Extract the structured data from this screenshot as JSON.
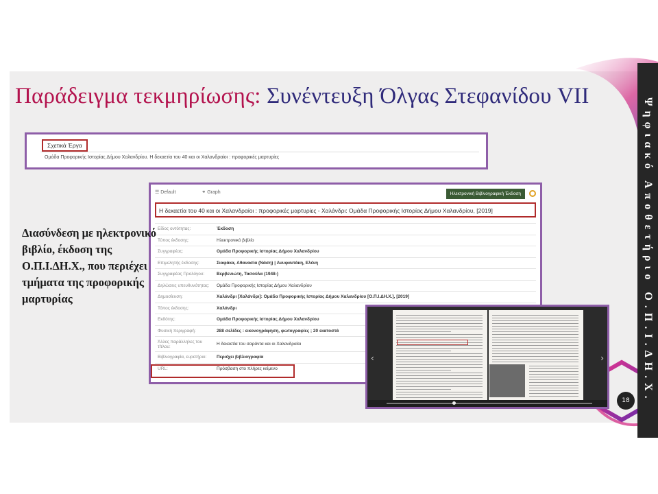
{
  "slide": {
    "title_part1": "Παράδειγμα τεκμηρίωσης:",
    "title_part2": "Συνέντευξη Όλγας Στεφανίδου VII",
    "side_text": "Διασύνδεση με ηλεκτρονικό βιβλίο, έκδοση της Ο.Π.Ι.ΔΗ.Χ., που περιέχει τμήματα της προφορικής μαρτυρίας",
    "sidebar_text": "Ψηφιακό  Αποθετήριο  Ο.Π.Ι.ΔΗ.Χ.",
    "page_number": "18"
  },
  "related": {
    "tab_label": "Σχετικά Έργα",
    "item": "Ομάδα Προφορικής Ιστορίας Δήμου Χαλανδρίου. Η δεκαετία του 40 και οι Χαλανδραίοι : προφορικές μαρτυρίες"
  },
  "record": {
    "tab_default": "Default",
    "tab_graph": "Graph",
    "publication_button": "Ηλεκτρονική Βιβλιογραφική Έκδοση",
    "title": "Η δεκαετία του 40 και οι Χαλανδραίοι : προφορικές μαρτυρίες - Χαλάνδρι: Ομάδα Προφορικής Ιστορίας Δήμου Χαλανδρίου, [2019]",
    "fields": [
      {
        "key": "Είδος οντότητας:",
        "value": "Έκδοση"
      },
      {
        "key": "Τύπος έκδοσης:",
        "value": "Ηλεκτρονικό βιβλίο"
      },
      {
        "key": "Συγγραφέας:",
        "value": "Ομάδα Προφορικής Ιστορίας Δήμου Χαλανδρίου"
      },
      {
        "key": "Επιμελητής έκδοσης:",
        "value": "Σιαφάκα, Αθανασία (Νάση) | Ανυφαντάκη, Ελένη"
      },
      {
        "key": "Συγγραφέας Προλόγου:",
        "value": "Βερβενιώτη, Τασούλα (1948-)"
      },
      {
        "key": "Δηλώσεις υπευθυνότητας:",
        "value": "Ομάδα Προφορικής Ιστορίας Δήμου Χαλανδρίου"
      },
      {
        "key": "Δημοσίευση:",
        "value": "Χαλάνδρι [Χαλάνδρι]: Ομάδα Προφορικής Ιστορίας Δήμου Χαλανδρίου [Ο.Π.Ι.ΔΗ.Χ.], [2019]"
      },
      {
        "key": "Τόπος έκδοσης:",
        "value": "Χαλάνδρι"
      },
      {
        "key": "Εκδότης:",
        "value": "Ομάδα Προφορικής Ιστορίας Δήμου Χαλανδρίου"
      },
      {
        "key": "Φυσική περιγραφή:",
        "value": "288 σελίδες : εικονογράφηση, φωτογραφίες ; 20 εκατοστά"
      },
      {
        "key": "Άλλες παράλληλες του τίτλου:",
        "value": "Η δεκαετία του σαράντα και οι Χαλανδραίοι"
      },
      {
        "key": "Βιβλιογραφία, ευρετήριο:",
        "value": "Περιέχει βιβλιογραφία"
      },
      {
        "key": "URL:",
        "value": "Πρόσβαση στο πλήρες κείμενο"
      }
    ]
  },
  "viewer": {
    "prev_icon": "chevron-left-icon",
    "next_icon": "chevron-right-icon",
    "progress": 0.32
  },
  "colors": {
    "title_red": "#b3124d",
    "title_blue": "#2f2a7a",
    "frame_purple": "#8e5ea8",
    "highlight_red": "#b02a2a"
  }
}
